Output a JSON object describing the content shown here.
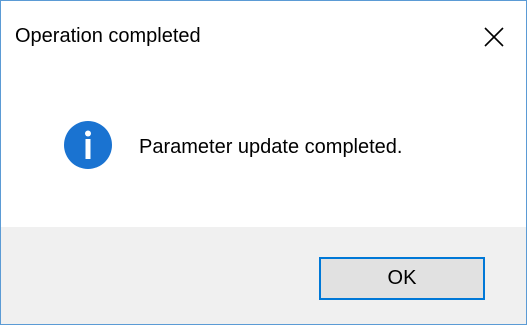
{
  "dialog": {
    "title": "Operation completed",
    "message": "Parameter update completed.",
    "icon": "info-icon",
    "buttons": {
      "ok_label": "OK"
    }
  },
  "colors": {
    "accent": "#0078d7",
    "info_icon": "#1a73d1",
    "footer_bg": "#f0f0f0",
    "button_bg": "#e1e1e1",
    "window_border": "#5b9bd5"
  }
}
